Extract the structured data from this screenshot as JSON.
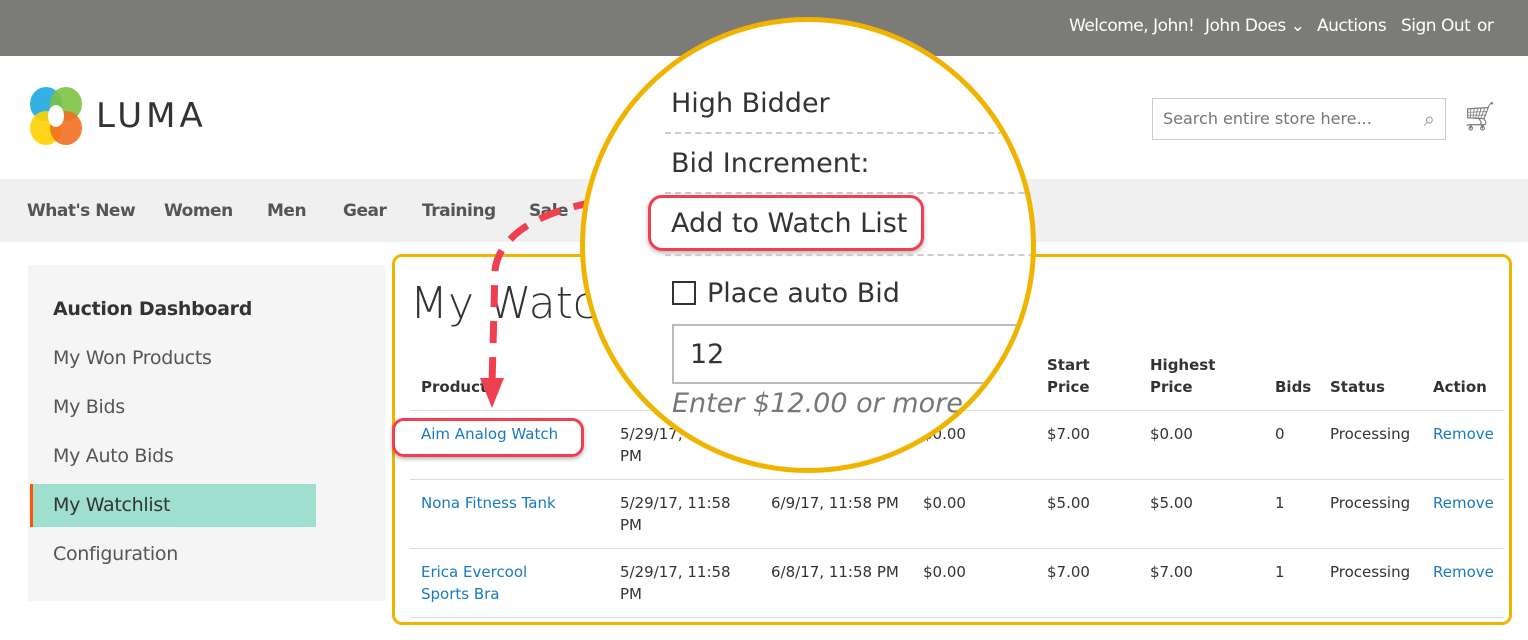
{
  "topbar": {
    "welcome": "Welcome, John!",
    "account": "John Does",
    "auctions": "Auctions",
    "sign_out": "Sign Out",
    "or": "or"
  },
  "header": {
    "logo": "LUMA",
    "search_placeholder": "Search entire store here..."
  },
  "nav": [
    "What's New",
    "Women",
    "Men",
    "Gear",
    "Training",
    "Sale"
  ],
  "sidebar": {
    "title": "Auction Dashboard",
    "items": [
      "My Won Products",
      "My Bids",
      "My Auto Bids",
      "My Watchlist",
      "Configuration"
    ],
    "active": "My Watchlist"
  },
  "main": {
    "title": "My Watchlist",
    "headers": {
      "product": "Product",
      "start_price": [
        "Start",
        "Price"
      ],
      "highest_price": [
        "Highest",
        "Price"
      ],
      "bids": "Bids",
      "status": "Status",
      "action": "Action"
    },
    "rows": [
      {
        "product": "Aim Analog Watch",
        "start": "5/29/17, 11:58 PM",
        "end": "",
        "current": "$0.00",
        "start_price": "$7.00",
        "highest": "$0.00",
        "bids": "0",
        "status": "Processing",
        "action": "Remove"
      },
      {
        "product": "Nona Fitness Tank",
        "start": "5/29/17, 11:58 PM",
        "end": "6/9/17, 11:58 PM",
        "current": "$0.00",
        "start_price": "$5.00",
        "highest": "$5.00",
        "bids": "1",
        "status": "Processing",
        "action": "Remove"
      },
      {
        "product": "Erica Evercool Sports Bra",
        "start": "5/29/17, 11:58 PM",
        "end": "6/8/17, 11:58 PM",
        "current": "$0.00",
        "start_price": "$7.00",
        "highest": "$7.00",
        "bids": "1",
        "status": "Processing",
        "action": "Remove"
      }
    ]
  },
  "magnifier": {
    "high_bidder": "High Bidder",
    "bid_increment": "Bid Increment:",
    "add_to_watch": "Add to Watch List",
    "auto_bid": "Place auto Bid",
    "bid_value": "12",
    "hint": "Enter $12.00 or more"
  },
  "colors": {
    "link": "#1979c3",
    "highlight": "#f0b400",
    "annotation": "#f04050",
    "active_item": "#9fdfd0"
  }
}
